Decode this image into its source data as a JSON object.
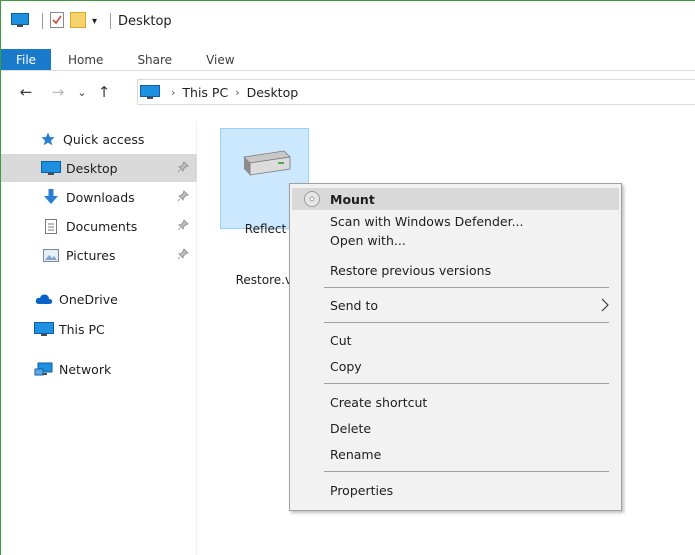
{
  "titlebar": {
    "title": "Desktop",
    "icons": [
      "monitor-icon",
      "checklist-icon",
      "folder-icon",
      "customize-qat-icon"
    ],
    "qat_arrow": "▾"
  },
  "ribbon": {
    "tabs": [
      "File",
      "Home",
      "Share",
      "View"
    ]
  },
  "nav": {
    "back": "←",
    "forward": "→",
    "recent": "⌄",
    "up": "↑",
    "breadcrumb": [
      "This PC",
      "Desktop"
    ],
    "crumb_sep": "›"
  },
  "navpane": {
    "items": [
      {
        "label": "Quick access",
        "icon": "star-icon"
      },
      {
        "label": "Desktop",
        "icon": "desktop-icon",
        "pinned": true,
        "selected": true
      },
      {
        "label": "Downloads",
        "icon": "download-icon",
        "pinned": true
      },
      {
        "label": "Documents",
        "icon": "document-icon",
        "pinned": true
      },
      {
        "label": "Pictures",
        "icon": "pictures-icon",
        "pinned": true
      },
      {
        "label": "OneDrive",
        "icon": "cloud-icon"
      },
      {
        "label": "This PC",
        "icon": "monitor-icon"
      },
      {
        "label": "Network",
        "icon": "network-icon"
      }
    ]
  },
  "file": {
    "line1": "Reflect",
    "line2": "Restore.vl",
    "icon": "drive-icon"
  },
  "context_menu": {
    "items": [
      {
        "label": "Mount",
        "bold": true,
        "hover": true,
        "icon": "disc-icon"
      },
      {
        "label": "Scan with Windows Defender..."
      },
      {
        "label": "Open with..."
      },
      {
        "label": "Restore previous versions"
      },
      {
        "label": "Send to",
        "submenu": true
      },
      {
        "label": "Cut"
      },
      {
        "label": "Copy"
      },
      {
        "label": "Create shortcut"
      },
      {
        "label": "Delete"
      },
      {
        "label": "Rename"
      },
      {
        "label": "Properties"
      }
    ],
    "submenu_arrow": "›"
  },
  "colors": {
    "accent": "#1979ca",
    "selection": "#cce8ff",
    "menu_bg": "#f2f2f2",
    "hover": "#d9d9d9"
  }
}
